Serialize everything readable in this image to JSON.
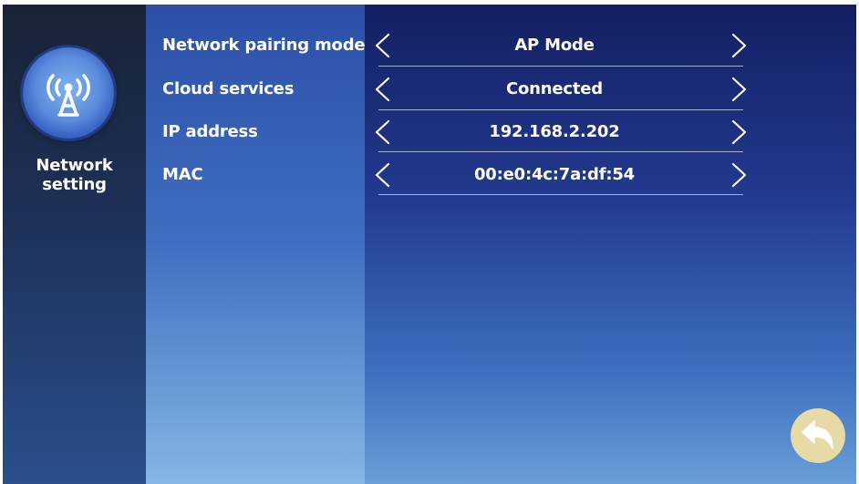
{
  "sidebar": {
    "category": {
      "label": "Network setting",
      "icon": "antenna-signal-icon"
    }
  },
  "settings": [
    {
      "label": "Network pairing mode",
      "value": "AP Mode"
    },
    {
      "label": "Cloud services",
      "value": "Connected"
    },
    {
      "label": "IP address",
      "value": "192.168.2.202"
    },
    {
      "label": "MAC",
      "value": "00:e0:4c:7a:df:54"
    }
  ],
  "back_button": {
    "icon": "back-arrow-icon"
  },
  "colors": {
    "back_button": "#e6dba4",
    "text": "#ffffff"
  }
}
